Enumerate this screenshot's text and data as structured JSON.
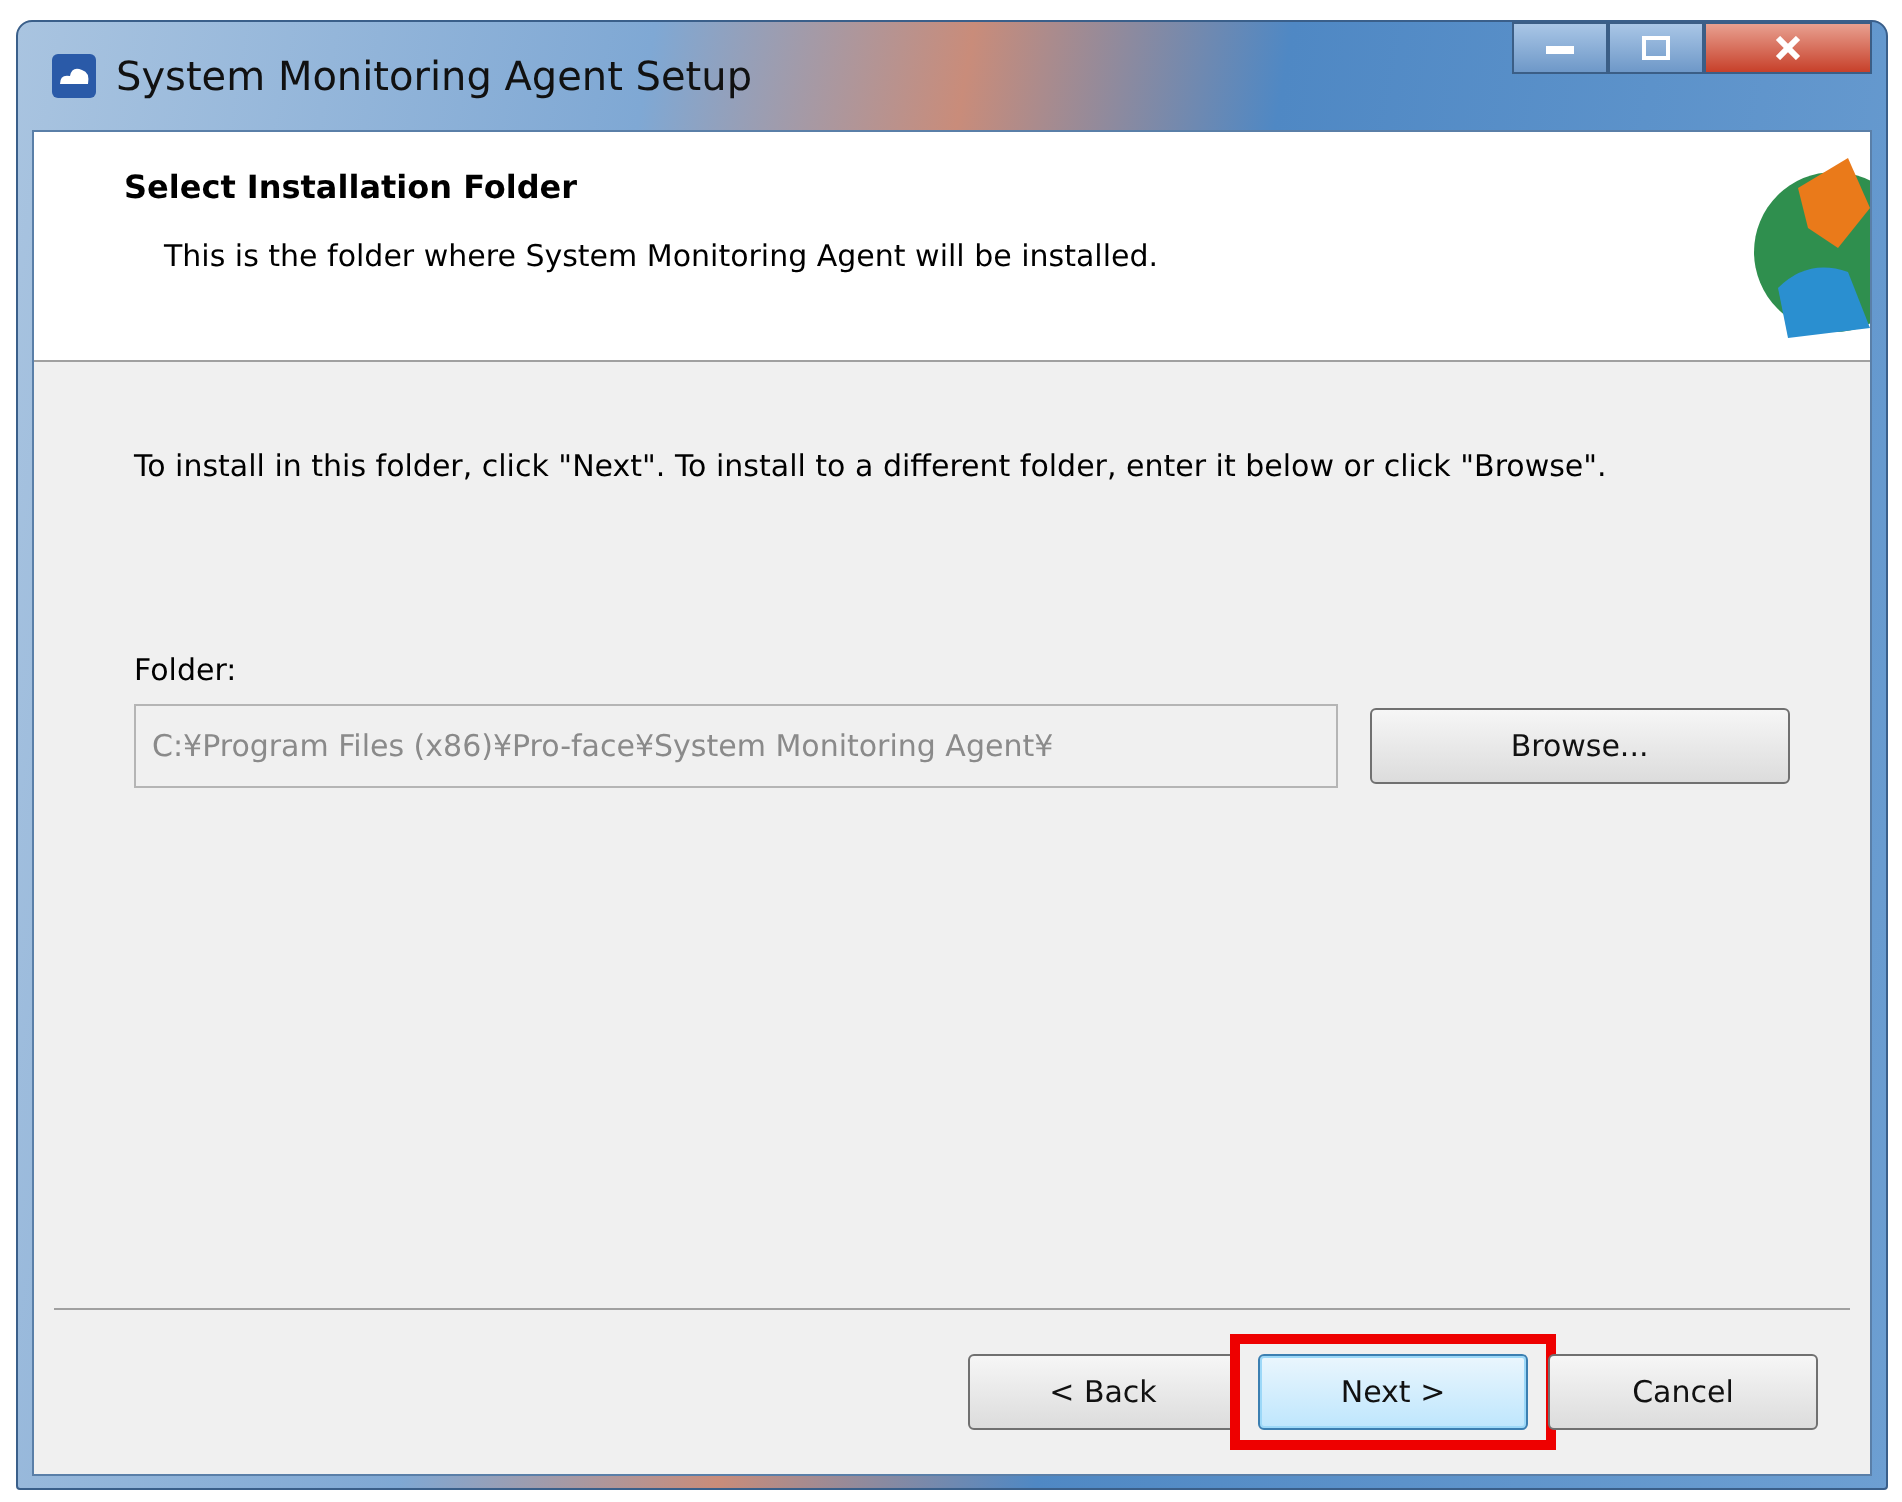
{
  "window": {
    "title": "System Monitoring Agent Setup"
  },
  "header": {
    "title": "Select Installation Folder",
    "subtitle": "This is the folder where System Monitoring Agent will be installed."
  },
  "instructions": "To install in this folder, click \"Next\". To install to a different folder, enter it below or click \"Browse\".",
  "folder": {
    "label": "Folder:",
    "value": "C:¥Program Files (x86)¥Pro-face¥System Monitoring Agent¥",
    "disabled": true
  },
  "browse_button": "Browse...",
  "buttons": [
    {
      "label": "< Back",
      "default": false,
      "highlighted": false
    },
    {
      "label": "Next >",
      "default": true,
      "highlighted": true
    },
    {
      "label": "Cancel",
      "default": false,
      "highlighted": false
    }
  ]
}
